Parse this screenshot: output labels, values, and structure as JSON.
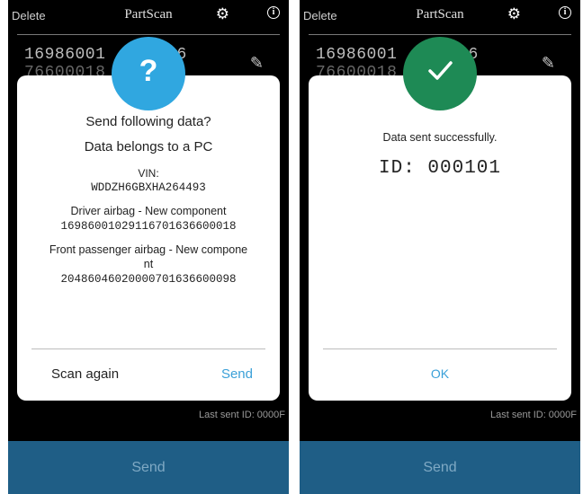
{
  "app": {
    "title": "PartScan",
    "delete_label": "Delete"
  },
  "background": {
    "code_line1": "16986001    7016",
    "code_line2": "76600018",
    "last_sent": "Last sent ID: 0000F",
    "send_button": "Send"
  },
  "confirm_dialog": {
    "question": "Send following data?",
    "belongs": "Data belongs to a PC",
    "vin_label": "VIN:",
    "vin_value": "WDDZH6GBXHA264493",
    "part1_label": "Driver airbag - New component",
    "part1_value": "16986001029116701636600018",
    "part2_label_line1": "Front passenger airbag - New compone",
    "part2_label_line2": "nt",
    "part2_value": "20486046020000701636600098",
    "scan_again": "Scan again",
    "send": "Send",
    "badge_glyph": "?"
  },
  "success_dialog": {
    "message": "Data sent successfully.",
    "id_text": "ID: 000101",
    "ok": "OK"
  },
  "icons": {
    "gear": "gear-icon",
    "info": "info-icon",
    "pencil": "pencil-icon",
    "question": "question-icon",
    "check": "checkmark-icon"
  },
  "colors": {
    "accent_blue": "#30a7e0",
    "success_green": "#1e8a55",
    "send_bar": "#1f5e86",
    "link_blue": "#3aa0d8"
  }
}
